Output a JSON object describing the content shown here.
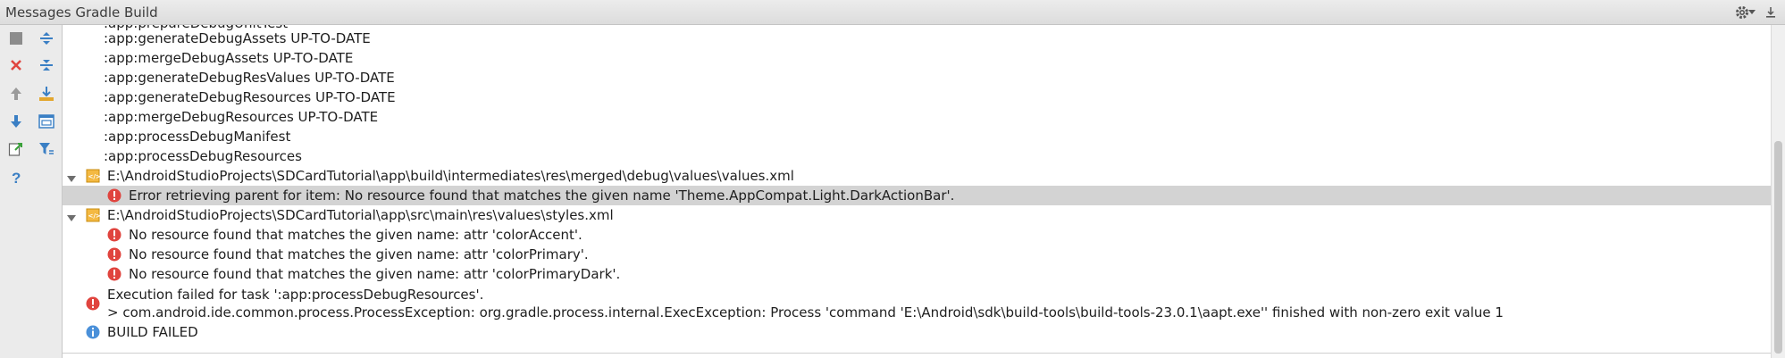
{
  "window": {
    "title": "Messages Gradle Build"
  },
  "title_icons": [
    "gear-icon",
    "minimize-icon"
  ],
  "toolbar": {
    "col1": [
      "stop-icon",
      "close-icon",
      "arrow-up-icon",
      "arrow-down-icon",
      "export-icon",
      "help-icon"
    ],
    "col2": [
      "expand-all-icon",
      "collapse-all-icon",
      "download-icon",
      "preview-icon",
      "filter-icon"
    ]
  },
  "log": {
    "top_lines": [
      ":app:generateDebugAssets UP-TO-DATE",
      ":app:mergeDebugAssets UP-TO-DATE",
      ":app:generateDebugResValues UP-TO-DATE",
      ":app:generateDebugResources UP-TO-DATE",
      ":app:mergeDebugResources UP-TO-DATE",
      ":app:processDebugManifest",
      ":app:processDebugResources"
    ],
    "file1": {
      "path": "E:\\AndroidStudioProjects\\SDCardTutorial\\app\\build\\intermediates\\res\\merged\\debug\\values\\values.xml",
      "errors": [
        "Error retrieving parent for item: No resource found that matches the given name 'Theme.AppCompat.Light.DarkActionBar'."
      ]
    },
    "file2": {
      "path": "E:\\AndroidStudioProjects\\SDCardTutorial\\app\\src\\main\\res\\values\\styles.xml",
      "errors": [
        "No resource found that matches the given name: attr 'colorAccent'.",
        "No resource found that matches the given name: attr 'colorPrimary'.",
        "No resource found that matches the given name: attr 'colorPrimaryDark'."
      ]
    },
    "exec_failed": {
      "line1": "Execution failed for task ':app:processDebugResources'.",
      "line2": "> com.android.ide.common.process.ProcessException: org.gradle.process.internal.ExecException: Process 'command 'E:\\Android\\sdk\\build-tools\\build-tools-23.0.1\\aapt.exe'' finished with non-zero exit value 1"
    },
    "build_status": "BUILD FAILED"
  },
  "colors": {
    "error": "#e0443e",
    "info": "#4a90d9",
    "selection": "#d3d3d3",
    "toolbar_blue": "#3a7fc4"
  }
}
